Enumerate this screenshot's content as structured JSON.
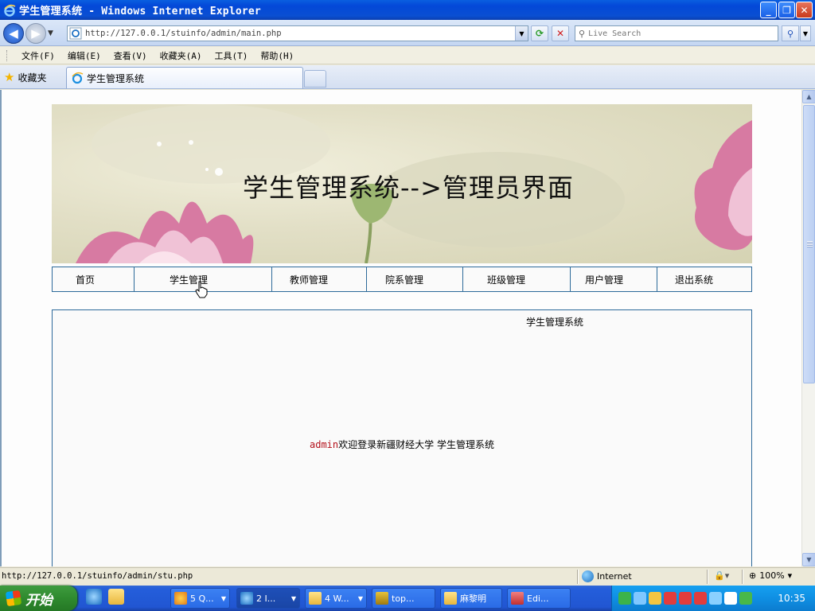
{
  "window": {
    "title": "学生管理系统 - Windows Internet Explorer",
    "buttons": {
      "minimize": "_",
      "maximize": "❐",
      "close": "✕"
    }
  },
  "addressbar": {
    "url": "http://127.0.0.1/stuinfo/admin/main.php",
    "search_placeholder": "Live Search"
  },
  "menu": {
    "items": [
      "文件(F)",
      "编辑(E)",
      "查看(V)",
      "收藏夹(A)",
      "工具(T)",
      "帮助(H)"
    ]
  },
  "tabs": {
    "favorites_label": "收藏夹",
    "active_tab": "学生管理系统"
  },
  "page": {
    "banner_title": "学生管理系统-->管理员界面",
    "nav": [
      "首页",
      "学生管理",
      "教师管理",
      "院系管理",
      "班级管理",
      "用户管理",
      "退出系统"
    ],
    "content_heading": "学生管理系统",
    "welcome_user": "admin",
    "welcome_text": "欢迎登录新疆财经大学  学生管理系统"
  },
  "statusbar": {
    "status_text": "http://127.0.0.1/stuinfo/admin/stu.php",
    "zone": "Internet",
    "zoom": "100%"
  },
  "taskbar": {
    "start_label": "开始",
    "buttons": [
      {
        "label": "5 Q..."
      },
      {
        "label": "2 I..."
      },
      {
        "label": "4 W..."
      },
      {
        "label": "top..."
      },
      {
        "label": "麻黎明"
      },
      {
        "label": "Edi..."
      }
    ],
    "clock": "10:35"
  },
  "colors": {
    "titlebar": "#0348d8",
    "nav_border": "#2d6a9a",
    "welcome_user": "#b3101a",
    "start_green": "#2f8a2f"
  }
}
